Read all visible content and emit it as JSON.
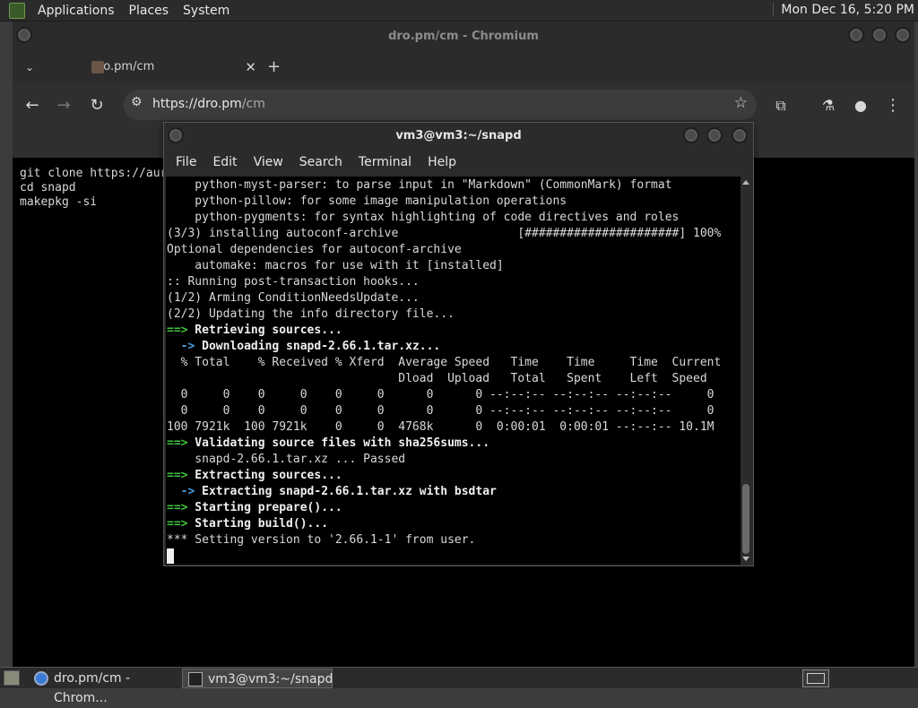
{
  "top_panel": {
    "menus": [
      "Applications",
      "Places",
      "System"
    ],
    "clock": "Mon Dec 16,  5:20 PM"
  },
  "browser": {
    "window_title": "dro.pm/cm - Chromium",
    "tab_title": "dro.pm/cm",
    "url_scheme": "https://",
    "url_host": "dro.pm",
    "url_path": "/cm",
    "page_lines": "git clone https://aur\ncd snapd\nmakepkg -si"
  },
  "terminal": {
    "title": "vm3@vm3:~/snapd",
    "menus": [
      "File",
      "Edit",
      "View",
      "Search",
      "Terminal",
      "Help"
    ],
    "lines": [
      {
        "t": "    python-myst-parser: to parse input in \"Markdown\" (CommonMark) format"
      },
      {
        "t": "    python-pillow: for some image manipulation operations"
      },
      {
        "t": "    python-pygments: for syntax highlighting of code directives and roles"
      },
      {
        "t": "(3/3) installing autoconf-archive                 [######################] 100%"
      },
      {
        "t": "Optional dependencies for autoconf-archive"
      },
      {
        "t": "    automake: macros for use with it [installed]"
      },
      {
        "t": ":: Running post-transaction hooks..."
      },
      {
        "t": "(1/2) Arming ConditionNeedsUpdate..."
      },
      {
        "t": "(2/2) Updating the info directory file..."
      },
      {
        "p": "==>",
        "pc": "g",
        "t": " Retrieving sources...",
        "tc": "b"
      },
      {
        "p": "  ->",
        "pc": "c",
        "t": " Downloading snapd-2.66.1.tar.xz...",
        "tc": "b"
      },
      {
        "t": "  % Total    % Received % Xferd  Average Speed   Time    Time     Time  Current"
      },
      {
        "t": "                                 Dload  Upload   Total   Spent    Left  Speed"
      },
      {
        "t": "  0     0    0     0    0     0      0      0 --:--:-- --:--:-- --:--:--     0"
      },
      {
        "t": "  0     0    0     0    0     0      0      0 --:--:-- --:--:-- --:--:--     0"
      },
      {
        "t": "100 7921k  100 7921k    0     0  4768k      0  0:00:01  0:00:01 --:--:-- 10.1M"
      },
      {
        "p": "==>",
        "pc": "g",
        "t": " Validating source files with sha256sums...",
        "tc": "b"
      },
      {
        "t": "    snapd-2.66.1.tar.xz ... Passed"
      },
      {
        "p": "==>",
        "pc": "g",
        "t": " Extracting sources...",
        "tc": "b"
      },
      {
        "p": "  ->",
        "pc": "c",
        "t": " Extracting snapd-2.66.1.tar.xz with bsdtar",
        "tc": "b"
      },
      {
        "p": "==>",
        "pc": "g",
        "t": " Starting prepare()...",
        "tc": "b"
      },
      {
        "p": "==>",
        "pc": "g",
        "t": " Starting build()...",
        "tc": "b"
      },
      {
        "t": "*** Setting version to '2.66.1-1' from user."
      }
    ]
  },
  "taskbar": {
    "tasks": [
      "dro.pm/cm - Chrom...",
      "vm3@vm3:~/snapd"
    ]
  }
}
